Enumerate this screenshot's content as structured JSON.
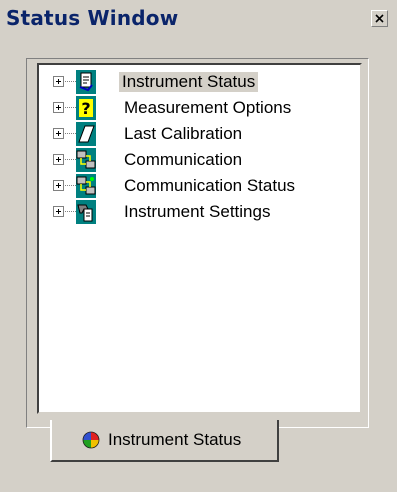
{
  "window": {
    "title": "Status Window",
    "close_glyph": "×"
  },
  "tree": {
    "items": [
      {
        "label": "Instrument Status",
        "icon": "instrument-status-icon",
        "selected": true
      },
      {
        "label": "Measurement Options",
        "icon": "question-icon",
        "selected": false
      },
      {
        "label": "Last Calibration",
        "icon": "calibration-icon",
        "selected": false
      },
      {
        "label": "Communication",
        "icon": "network-icon",
        "selected": false
      },
      {
        "label": "Communication Status",
        "icon": "network-status-icon",
        "selected": false
      },
      {
        "label": "Instrument Settings",
        "icon": "settings-icon",
        "selected": false
      }
    ]
  },
  "tabs": [
    {
      "label": "Instrument Status",
      "icon": "globe-icon",
      "active": true
    }
  ],
  "colors": {
    "title_text": "#0a246a",
    "icon_teal": "#008080",
    "face": "#d4d0c8"
  }
}
